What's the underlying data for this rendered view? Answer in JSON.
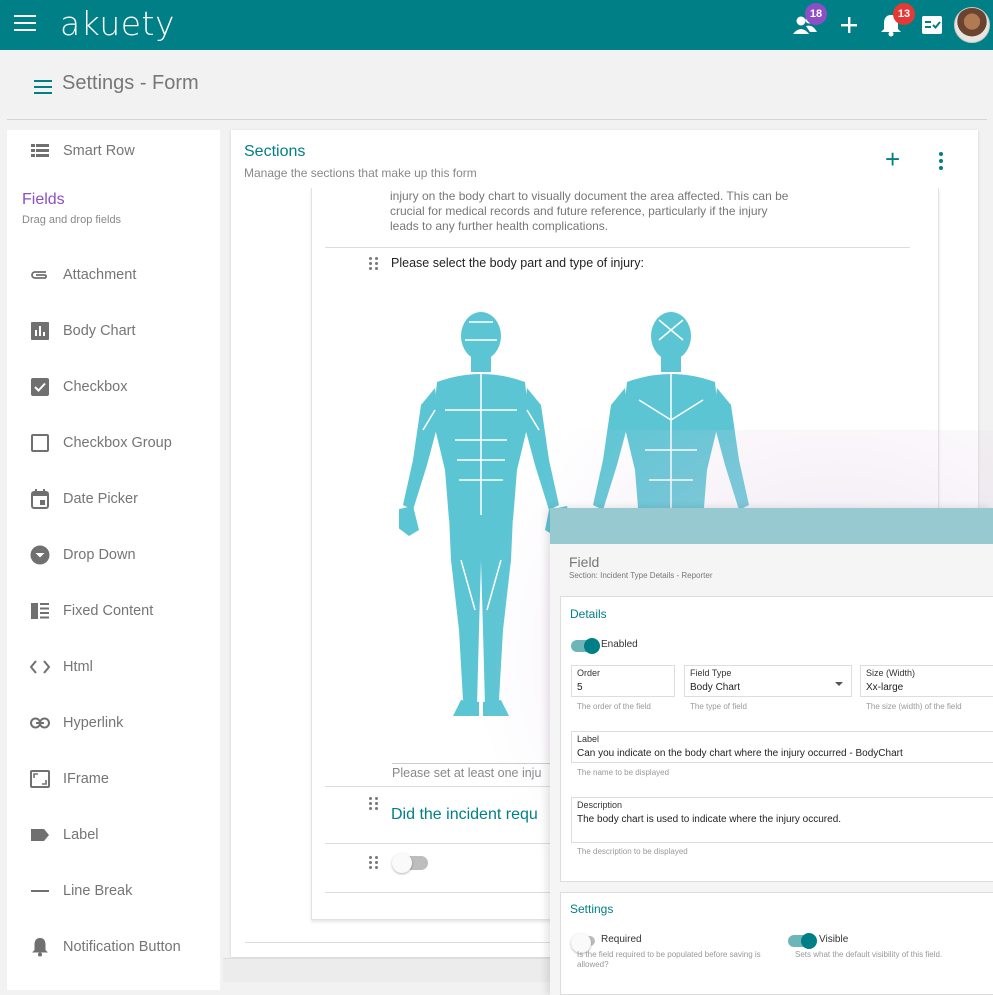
{
  "app": {
    "logo": "akuety",
    "people_badge": "18",
    "notif_badge": "13"
  },
  "page": {
    "title": "Settings - Form"
  },
  "sidebar": {
    "top_item": "Smart Row",
    "fields_heading": "Fields",
    "fields_sub": "Drag and drop fields",
    "items": [
      "Attachment",
      "Body Chart",
      "Checkbox",
      "Checkbox Group",
      "Date Picker",
      "Drop Down",
      "Fixed Content",
      "Html",
      "Hyperlink",
      "IFrame",
      "Label",
      "Line Break",
      "Notification Button"
    ]
  },
  "sections": {
    "title": "Sections",
    "subtitle": "Manage the sections that make up this form",
    "description_text": "injury on the body chart to visually document the area affected. This can be crucial for medical records and future reference, particularly if the injury leads to any further health complications.",
    "body_question": "Please select the body part and type of injury:",
    "body_hint": "Please set at least one inju",
    "question2": "Did the incident requ"
  },
  "field_panel": {
    "title": "Field",
    "subtitle": "Section: Incident Type Details - Reporter",
    "details_heading": "Details",
    "enabled_label": "Enabled",
    "order_label": "Order",
    "order_value": "5",
    "order_hint": "The order of the field",
    "type_label": "Field Type",
    "type_value": "Body Chart",
    "type_hint": "The type of field",
    "size_label": "Size (Width)",
    "size_value": "Xx-large",
    "size_hint": "The size (width) of the field",
    "label_label": "Label",
    "label_value": "Can you indicate on the body chart where the injury occurred - BodyChart",
    "label_hint": "The name to be displayed",
    "desc_label": "Description",
    "desc_value": "The body chart is used to indicate where the injury occured.",
    "desc_hint": "The description to be displayed",
    "settings_heading": "Settings",
    "required_label": "Required",
    "required_hint": "Is the field required to be populated before saving is allowed?",
    "visible_label": "Visible",
    "visible_hint": "Sets what the default visibility of this field."
  },
  "colors": {
    "primary": "#007f86",
    "accent": "#8e4ec6",
    "body": "#5bc5d3"
  }
}
